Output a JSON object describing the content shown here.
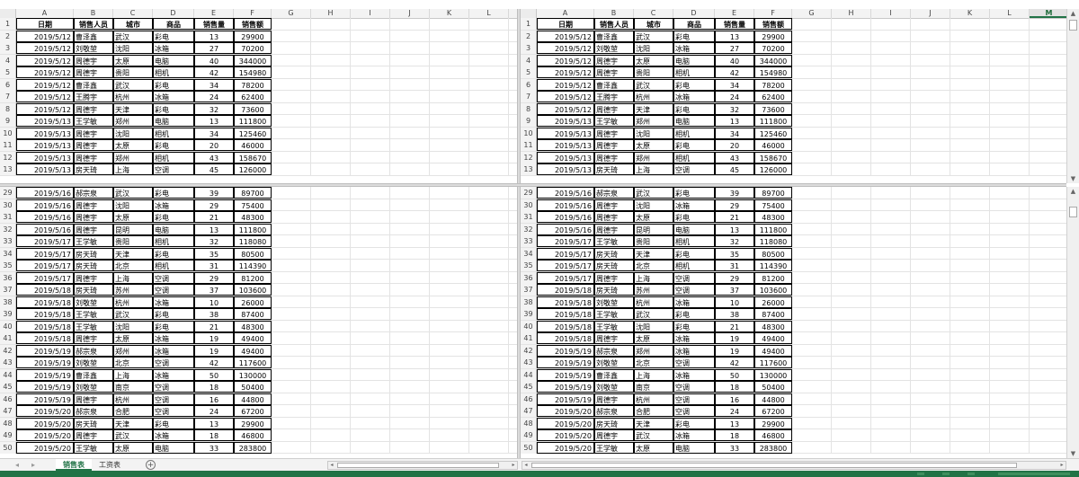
{
  "columns_left": [
    "A",
    "B",
    "C",
    "D",
    "E",
    "F",
    "G",
    "H",
    "I",
    "J",
    "K",
    "L"
  ],
  "columns_right": [
    "A",
    "B",
    "C",
    "D",
    "E",
    "F",
    "G",
    "H",
    "I",
    "J",
    "K",
    "L",
    "M"
  ],
  "selected_column": "M",
  "header_row": {
    "row": "1",
    "cells": [
      "日期",
      "销售人员",
      "城市",
      "商品",
      "销售量",
      "销售额"
    ]
  },
  "top_rows": [
    {
      "row": "2",
      "cells": [
        "2019/5/12",
        "曹泽鑫",
        "武汉",
        "彩电",
        "13",
        "29900"
      ]
    },
    {
      "row": "3",
      "cells": [
        "2019/5/12",
        "刘敬堃",
        "沈阳",
        "冰箱",
        "27",
        "70200"
      ]
    },
    {
      "row": "4",
      "cells": [
        "2019/5/12",
        "周德宇",
        "太原",
        "电脑",
        "40",
        "344000"
      ]
    },
    {
      "row": "5",
      "cells": [
        "2019/5/12",
        "周德宇",
        "贵阳",
        "相机",
        "42",
        "154980"
      ]
    },
    {
      "row": "6",
      "cells": [
        "2019/5/12",
        "曹泽鑫",
        "武汉",
        "彩电",
        "34",
        "78200"
      ]
    },
    {
      "row": "7",
      "cells": [
        "2019/5/12",
        "王腾宇",
        "杭州",
        "冰箱",
        "24",
        "62400"
      ]
    },
    {
      "row": "8",
      "cells": [
        "2019/5/12",
        "周德宇",
        "天津",
        "彩电",
        "32",
        "73600"
      ]
    },
    {
      "row": "9",
      "cells": [
        "2019/5/13",
        "王学敏",
        "郑州",
        "电脑",
        "13",
        "111800"
      ]
    },
    {
      "row": "10",
      "cells": [
        "2019/5/13",
        "周德宇",
        "沈阳",
        "相机",
        "34",
        "125460"
      ]
    },
    {
      "row": "11",
      "cells": [
        "2019/5/13",
        "周德宇",
        "太原",
        "彩电",
        "20",
        "46000"
      ]
    },
    {
      "row": "12",
      "cells": [
        "2019/5/13",
        "周德宇",
        "郑州",
        "相机",
        "43",
        "158670"
      ]
    },
    {
      "row": "13",
      "cells": [
        "2019/5/13",
        "房天琦",
        "上海",
        "空调",
        "45",
        "126000"
      ]
    }
  ],
  "bottom_rows": [
    {
      "row": "29",
      "cells": [
        "2019/5/16",
        "郝宗泉",
        "武汉",
        "彩电",
        "39",
        "89700"
      ]
    },
    {
      "row": "30",
      "cells": [
        "2019/5/16",
        "周德宇",
        "沈阳",
        "冰箱",
        "29",
        "75400"
      ]
    },
    {
      "row": "31",
      "cells": [
        "2019/5/16",
        "周德宇",
        "太原",
        "彩电",
        "21",
        "48300"
      ]
    },
    {
      "row": "32",
      "cells": [
        "2019/5/16",
        "周德宇",
        "昆明",
        "电脑",
        "13",
        "111800"
      ]
    },
    {
      "row": "33",
      "cells": [
        "2019/5/17",
        "王学敏",
        "贵阳",
        "相机",
        "32",
        "118080"
      ]
    },
    {
      "row": "34",
      "cells": [
        "2019/5/17",
        "房天琦",
        "天津",
        "彩电",
        "35",
        "80500"
      ]
    },
    {
      "row": "35",
      "cells": [
        "2019/5/17",
        "房天琦",
        "北京",
        "相机",
        "31",
        "114390"
      ]
    },
    {
      "row": "36",
      "cells": [
        "2019/5/17",
        "周德宇",
        "上海",
        "空调",
        "29",
        "81200"
      ]
    },
    {
      "row": "37",
      "cells": [
        "2019/5/18",
        "房天琦",
        "苏州",
        "空调",
        "37",
        "103600"
      ]
    },
    {
      "row": "38",
      "cells": [
        "2019/5/18",
        "刘敬堃",
        "杭州",
        "冰箱",
        "10",
        "26000"
      ]
    },
    {
      "row": "39",
      "cells": [
        "2019/5/18",
        "王学敏",
        "武汉",
        "彩电",
        "38",
        "87400"
      ]
    },
    {
      "row": "40",
      "cells": [
        "2019/5/18",
        "王学敏",
        "沈阳",
        "彩电",
        "21",
        "48300"
      ]
    },
    {
      "row": "41",
      "cells": [
        "2019/5/18",
        "周德宇",
        "太原",
        "冰箱",
        "19",
        "49400"
      ]
    },
    {
      "row": "42",
      "cells": [
        "2019/5/19",
        "郝宗泉",
        "郑州",
        "冰箱",
        "19",
        "49400"
      ]
    },
    {
      "row": "43",
      "cells": [
        "2019/5/19",
        "刘敬堃",
        "北京",
        "空调",
        "42",
        "117600"
      ]
    },
    {
      "row": "44",
      "cells": [
        "2019/5/19",
        "曹泽鑫",
        "上海",
        "冰箱",
        "50",
        "130000"
      ]
    },
    {
      "row": "45",
      "cells": [
        "2019/5/19",
        "刘敬堃",
        "南京",
        "空调",
        "18",
        "50400"
      ]
    },
    {
      "row": "46",
      "cells": [
        "2019/5/19",
        "周德宇",
        "杭州",
        "空调",
        "16",
        "44800"
      ]
    },
    {
      "row": "47",
      "cells": [
        "2019/5/20",
        "郝宗泉",
        "合肥",
        "空调",
        "24",
        "67200"
      ]
    },
    {
      "row": "48",
      "cells": [
        "2019/5/20",
        "房天琦",
        "天津",
        "彩电",
        "13",
        "29900"
      ]
    },
    {
      "row": "49",
      "cells": [
        "2019/5/20",
        "周德宇",
        "武汉",
        "冰箱",
        "18",
        "46800"
      ]
    },
    {
      "row": "50",
      "cells": [
        "2019/5/20",
        "王学敏",
        "太原",
        "电脑",
        "33",
        "283800"
      ]
    }
  ],
  "sheet_tabs": [
    {
      "label": "销售表",
      "active": true
    },
    {
      "label": "工资表",
      "active": false
    }
  ],
  "add_sheet_label": "+",
  "icons": {
    "nav_left": "◂",
    "nav_right": "▸",
    "scroll_up": "▲",
    "scroll_down": "▼",
    "scroll_left": "◂",
    "scroll_right": "▸"
  },
  "colors": {
    "accent": "#217346",
    "grid": "#e3e3e3",
    "header_bg": "#f3f3f3"
  }
}
